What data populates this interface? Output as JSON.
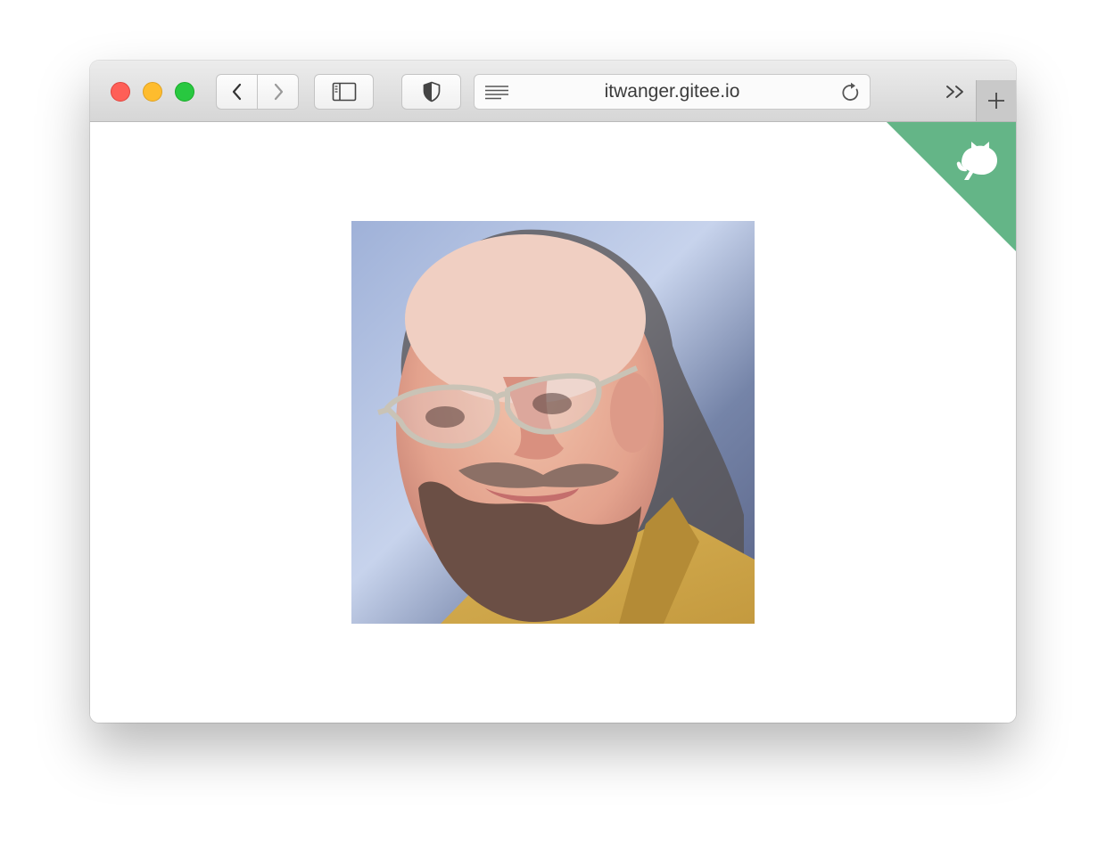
{
  "browser": {
    "address_bar": {
      "url": "itwanger.gitee.io"
    },
    "buttons": {
      "back_icon": "chevron-left-icon",
      "forward_icon": "chevron-right-icon",
      "sidebar_icon": "sidebar-icon",
      "privacy_icon": "shield-icon",
      "reader_icon": "reader-icon",
      "reload_icon": "reload-icon",
      "overflow_icon": "double-chevron-icon",
      "new_tab_icon": "plus-icon"
    },
    "colors": {
      "close": "#fe5f57",
      "minimize": "#febc2e",
      "zoom": "#28c840"
    }
  },
  "page": {
    "corner_ribbon": {
      "icon": "github-octocat-icon",
      "color": "#64b587"
    },
    "image": {
      "subject": "portrait-photo"
    }
  }
}
